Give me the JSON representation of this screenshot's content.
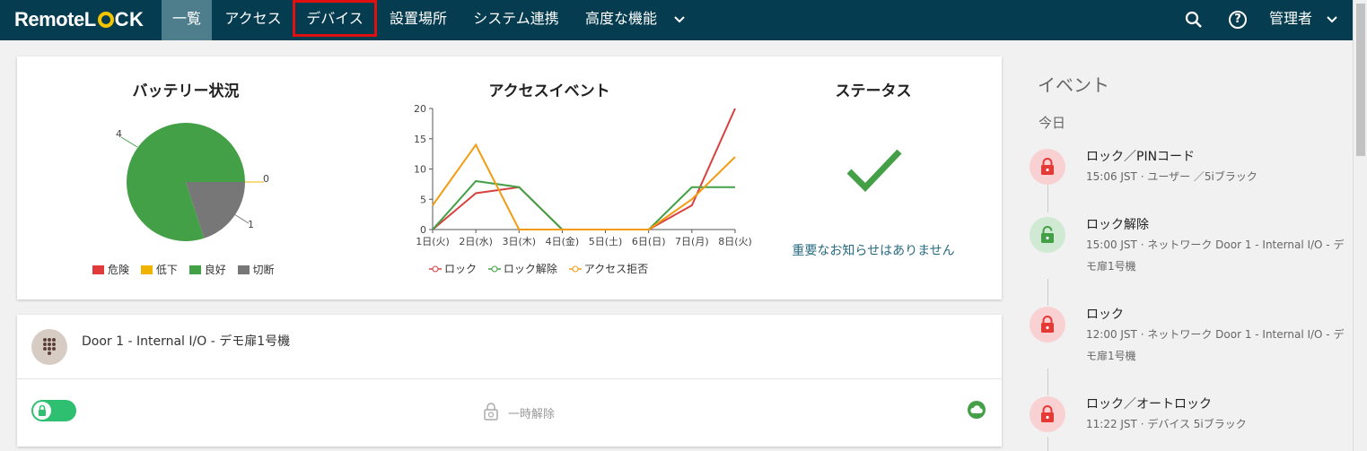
{
  "nav": {
    "logo_remote": "Remote",
    "logo_lock_l": "L",
    "logo_lock_ck": "CK",
    "items": [
      "一覧",
      "アクセス",
      "デバイス",
      "設置場所",
      "システム連携",
      "高度な機能"
    ],
    "search_icon": "search-icon",
    "help_icon": "help-icon",
    "user_label": "管理者"
  },
  "battery": {
    "title": "バッテリー状況",
    "legend": [
      "危険",
      "低下",
      "良好",
      "切断"
    ],
    "colors": [
      "#e03a3a",
      "#f0b400",
      "#43a047",
      "#777777"
    ]
  },
  "access": {
    "title": "アクセスイベント",
    "legend": [
      "ロック",
      "ロック解除",
      "アクセス拒否"
    ],
    "colors": [
      "#d94040",
      "#43a047",
      "#f39c12"
    ]
  },
  "status": {
    "title": "ステータス",
    "message": "重要なお知らせはありません"
  },
  "chart_data": [
    {
      "type": "pie",
      "title": "バッテリー状況",
      "categories": [
        "危険",
        "低下",
        "良好",
        "切断"
      ],
      "values": [
        0,
        0,
        4,
        1
      ],
      "slice_labels": [
        "4",
        "0",
        "1"
      ]
    },
    {
      "type": "line",
      "title": "アクセスイベント",
      "categories": [
        "1日(火)",
        "2日(水)",
        "3日(木)",
        "4日(金)",
        "5日(土)",
        "6日(日)",
        "7日(月)",
        "8日(火)"
      ],
      "ylim": [
        0,
        20
      ],
      "yticks": [
        "0",
        "5",
        "10",
        "15",
        "20"
      ],
      "series": [
        {
          "name": "ロック",
          "values": [
            0,
            6,
            7,
            0,
            0,
            0,
            4,
            20
          ]
        },
        {
          "name": "ロック解除",
          "values": [
            0,
            8,
            7,
            0,
            0,
            0,
            7,
            7
          ]
        },
        {
          "name": "アクセス拒否",
          "values": [
            4,
            14,
            0,
            0,
            0,
            0,
            5,
            12
          ]
        }
      ]
    }
  ],
  "device": {
    "name": "Door 1 - Internal I/O - デモ扉1号機",
    "temp_unlock": "一時解除"
  },
  "events": {
    "title": "イベント",
    "day": "今日",
    "items": [
      {
        "name": "ロック／PINコード",
        "meta": "15:06 JST · ユーザー ／5iブラック",
        "type": "lock"
      },
      {
        "name": "ロック解除",
        "meta": "15:00 JST · ネットワーク Door 1 - Internal I/O - デモ扉1号機",
        "type": "unlock"
      },
      {
        "name": "ロック",
        "meta": "12:00 JST · ネットワーク Door 1 - Internal I/O - デモ扉1号機",
        "type": "lock"
      },
      {
        "name": "ロック／オートロック",
        "meta": "11:22 JST · デバイス 5iブラック",
        "type": "lock"
      }
    ]
  }
}
